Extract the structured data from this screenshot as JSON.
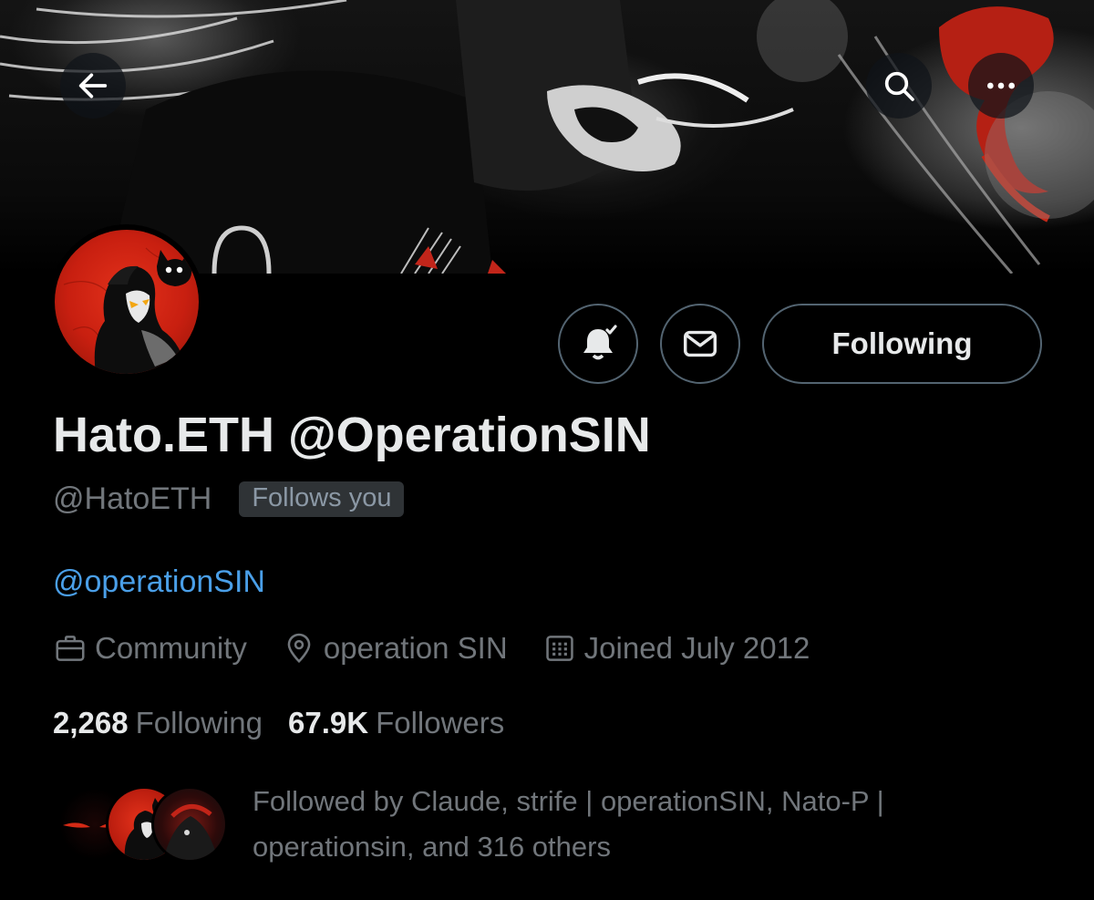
{
  "header": {
    "back_icon": "arrow-left-icon",
    "search_icon": "search-icon",
    "more_icon": "more-horizontal-icon"
  },
  "profile": {
    "display_name": "Hato.ETH @OperationSIN",
    "handle": "@HatoETH",
    "follows_you_badge": "Follows you",
    "bio_mention": "@operationSIN",
    "category": "Community",
    "location": "operation SIN",
    "joined": "Joined July 2012"
  },
  "actions": {
    "notify_icon": "bell-check-icon",
    "message_icon": "mail-icon",
    "following_label": "Following"
  },
  "stats": {
    "following_count": "2,268",
    "following_label": "Following",
    "followers_count": "67.9K",
    "followers_label": "Followers"
  },
  "followed_by": {
    "text": "Followed by Claude, strife | operationSIN, Nato-P | operationsin, and 316 others"
  },
  "colors": {
    "background": "#000000",
    "text_primary": "#e7e9ea",
    "text_secondary": "#71767b",
    "link": "#4a9fe8",
    "border": "#536471",
    "avatar_red": "#d42a16"
  }
}
